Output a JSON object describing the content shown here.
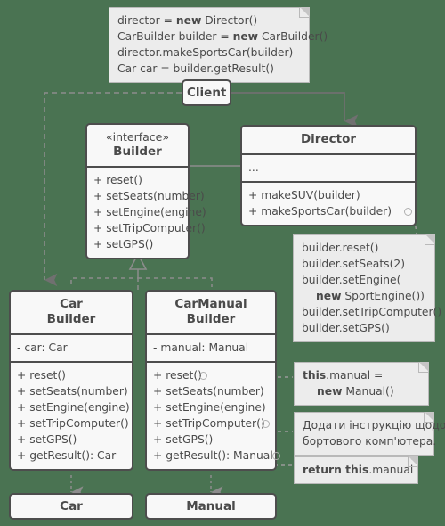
{
  "diagram": {
    "title": "Builder design pattern UML class diagram",
    "background_color": "#4a7352",
    "box_fill": "#f8f8f8",
    "note_fill": "#ececec",
    "stroke_color": "#4d4d4d",
    "text_color": "#4a4a4a"
  },
  "client_note": {
    "lines": [
      {
        "pre": "director = ",
        "bold": "new",
        "post": " Director()"
      },
      {
        "pre": "CarBuilder builder = ",
        "bold": "new",
        "post": " CarBuilder()"
      },
      {
        "pre": "director.makeSportsCar(builder)",
        "bold": "",
        "post": ""
      },
      {
        "pre": "Car car = builder.getResult()",
        "bold": "",
        "post": ""
      }
    ]
  },
  "client": {
    "title": "Client"
  },
  "builder_interface": {
    "stereotype": "«interface»",
    "title": "Builder",
    "methods": [
      "+ reset()",
      "+ setSeats(number)",
      "+ setEngine(engine)",
      "+ setTripComputer()",
      "+ setGPS()"
    ]
  },
  "director": {
    "title": "Director",
    "fields": [
      "..."
    ],
    "methods": [
      "+ makeSUV(builder)",
      "+ makeSportsCar(builder)"
    ]
  },
  "director_note": {
    "lines": [
      {
        "pre": "builder.reset()",
        "bold": "",
        "post": "",
        "indent": false
      },
      {
        "pre": "builder.setSeats(2)",
        "bold": "",
        "post": "",
        "indent": false
      },
      {
        "pre": "builder.setEngine(",
        "bold": "",
        "post": "",
        "indent": false
      },
      {
        "pre": "",
        "bold": "new",
        "post": " SportEngine())",
        "indent": true
      },
      {
        "pre": "builder.setTripComputer()",
        "bold": "",
        "post": "",
        "indent": false
      },
      {
        "pre": "builder.setGPS()",
        "bold": "",
        "post": "",
        "indent": false
      }
    ]
  },
  "car_builder": {
    "title_line1": "Car",
    "title_line2": "Builder",
    "fields": [
      "- car: Car"
    ],
    "methods": [
      "+ reset()",
      "+ setSeats(number)",
      "+ setEngine(engine)",
      "+ setTripComputer()",
      "+ setGPS()",
      "+ getResult(): Car"
    ]
  },
  "car_manual_builder": {
    "title_line1": "CarManual",
    "title_line2": "Builder",
    "fields": [
      "- manual: Manual"
    ],
    "methods": [
      "+ reset()",
      "+ setSeats(number)",
      "+ setEngine(engine)",
      "+ setTripComputer()",
      "+ setGPS()",
      "+ getResult(): Manual"
    ]
  },
  "note_reset": {
    "lines": [
      {
        "pre": "",
        "bold": "this",
        "post": ".manual =",
        "indent": false
      },
      {
        "pre": "",
        "bold": "new",
        "post": " Manual()",
        "indent": true
      }
    ]
  },
  "note_trip_computer": {
    "lines": [
      {
        "pre": "Додати інструкцію щодо",
        "bold": "",
        "post": "",
        "indent": false
      },
      {
        "pre": "бортового комп'ютера.",
        "bold": "",
        "post": "",
        "indent": false
      }
    ]
  },
  "note_get_result": {
    "lines": [
      {
        "pre": "",
        "bold": "return this",
        "post": ".manual",
        "indent": false
      }
    ]
  },
  "car_product": {
    "title": "Car"
  },
  "manual_product": {
    "title": "Manual"
  }
}
